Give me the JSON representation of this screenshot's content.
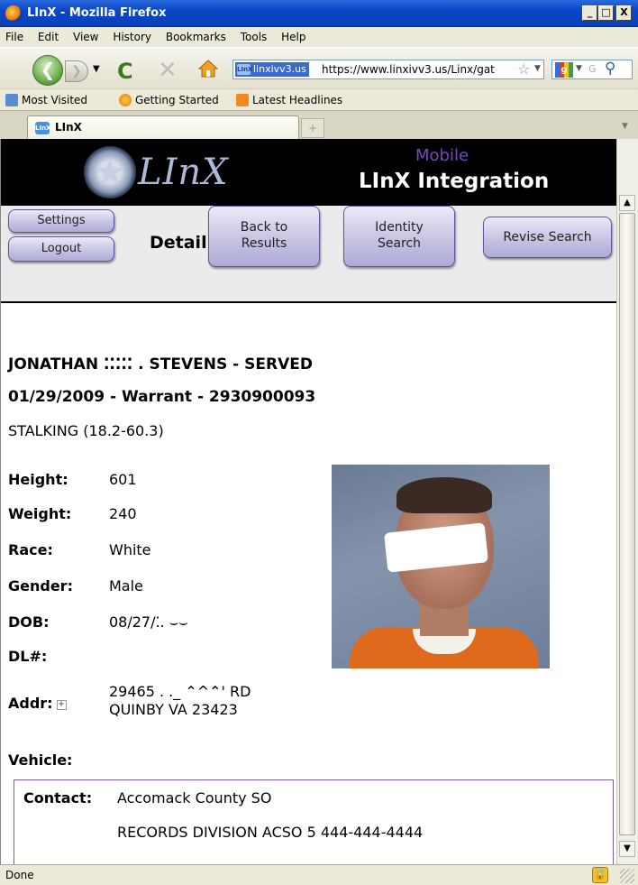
{
  "window": {
    "title": "LInX - Mozilla Firefox",
    "controls": {
      "minimize": "_",
      "maximize": "□",
      "close": "X"
    }
  },
  "menubar": [
    "File",
    "Edit",
    "View",
    "History",
    "Bookmarks",
    "Tools",
    "Help"
  ],
  "navbar": {
    "site_identity": "linxivv3.us",
    "url": "https://www.linxivv3.us/Linx/gat",
    "search_placeholder": "G"
  },
  "bookmarks": [
    "Most Visited",
    "Getting Started",
    "Latest Headlines"
  ],
  "tabs": [
    {
      "label": "LInX"
    }
  ],
  "app": {
    "logo_text": "LInX",
    "mobile_label": "Mobile",
    "title": "LInX Integration"
  },
  "toolbar": {
    "settings": "Settings",
    "logout": "Logout",
    "detail": "Detail",
    "back_to_results": [
      "Back to",
      "Results"
    ],
    "identity_search": [
      "Identity",
      "Search"
    ],
    "revise_search": "Revise Search"
  },
  "record": {
    "name_line": "JONATHAN ⁚⁚⁚⁚⁚ .  STEVENS - SERVED",
    "warrant_line": "01/29/2009 - Warrant - 2930900093",
    "offense_line": "STALKING (18.2-60.3)",
    "fields": [
      {
        "label": "Height:",
        "value": "601"
      },
      {
        "label": "Weight:",
        "value": "240"
      },
      {
        "label": "Race:",
        "value": "White"
      },
      {
        "label": "Gender:",
        "value": "Male"
      },
      {
        "label": "DOB:",
        "value": "08/27/⁚. ⌣⌣"
      },
      {
        "label": "DL#:",
        "value": ""
      }
    ],
    "addr_label": "Addr:",
    "addr_line1": "29465 . ._ ⌃^⌃'  RD",
    "addr_line2": "QUINBY VA 23423",
    "vehicle_label": "Vehicle:",
    "contact_label": "Contact:",
    "contact_agency": "Accomack County SO",
    "contact_detail": "RECORDS DIVISION ACSO 5 444-444-4444"
  },
  "statusbar": {
    "text": "Done"
  }
}
